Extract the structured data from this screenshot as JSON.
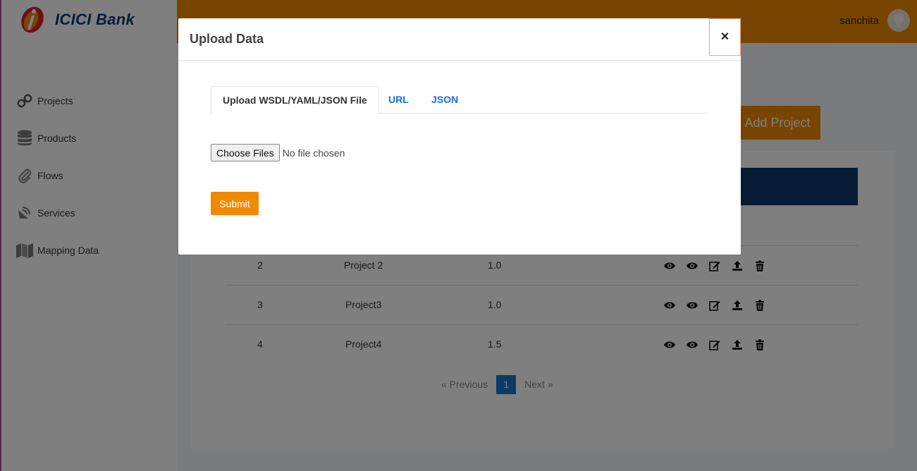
{
  "brand": {
    "logo_text": "ICICI Bank"
  },
  "sidebar": {
    "items": [
      {
        "label": "Projects",
        "icon": "link-icon"
      },
      {
        "label": "Products",
        "icon": "database-icon"
      },
      {
        "label": "Flows",
        "icon": "paperclip-icon"
      },
      {
        "label": "Services",
        "icon": "satellite-dish-icon"
      },
      {
        "label": "Mapping Data",
        "icon": "map-icon"
      }
    ]
  },
  "header": {
    "username": "sanchita"
  },
  "main": {
    "add_project_label": "Add Project",
    "rows": [
      {
        "id": "2",
        "name": "Project 2",
        "version": "1.0"
      },
      {
        "id": "3",
        "name": "Project3",
        "version": "1.0"
      },
      {
        "id": "4",
        "name": "Project4",
        "version": "1.5"
      }
    ],
    "pagination": {
      "prev": "«  Previous",
      "current": "1",
      "next": "Next  »"
    }
  },
  "modal": {
    "title": "Upload Data",
    "close_label": "×",
    "tabs": [
      "Upload WSDL/YAML/JSON File",
      "URL",
      "JSON"
    ],
    "choose_files_label": "Choose Files",
    "file_status": "No file chosen",
    "submit_label": "Submit"
  },
  "colors": {
    "accent": "#f08a00",
    "table_header": "#0a3868",
    "link": "#1a6fd6",
    "pager_active": "#1677c9"
  }
}
